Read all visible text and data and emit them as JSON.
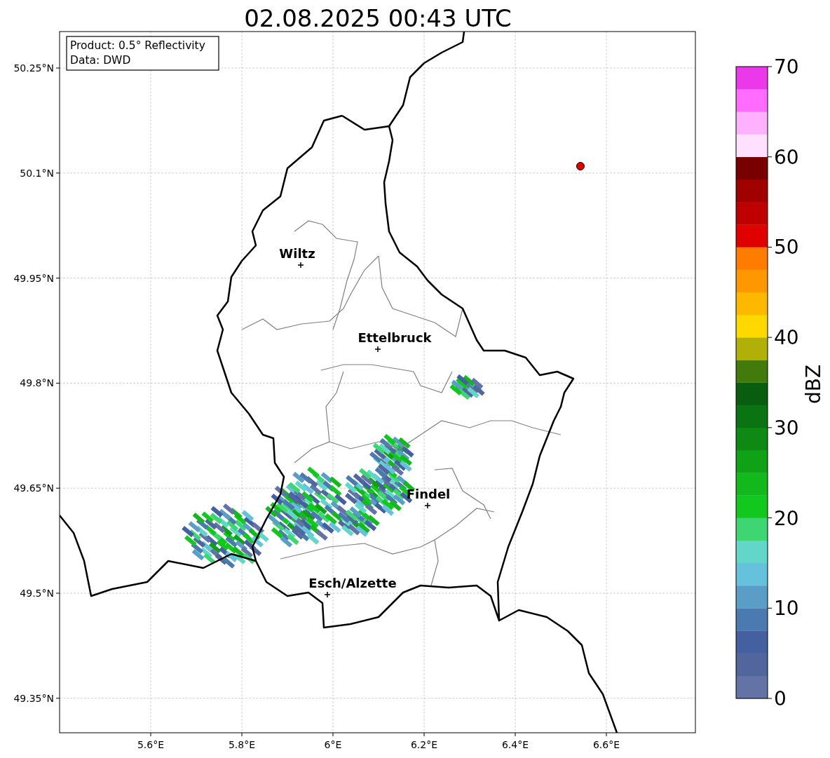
{
  "title": "02.08.2025 00:43 UTC",
  "info_box": [
    "Product: 0.5° Reflectivity",
    "Data: DWD"
  ],
  "map": {
    "yticks": [
      "50.25°N",
      "50.1°N",
      "49.95°N",
      "49.8°N",
      "49.65°N",
      "49.5°N",
      "49.35°N"
    ],
    "xticks": [
      "5.6°E",
      "5.8°E",
      "6°E",
      "6.2°E",
      "6.4°E",
      "6.6°E"
    ],
    "cities": [
      "Wiltz",
      "Ettelbruck",
      "Findel",
      "Esch/Alzette"
    ]
  },
  "colorbar": {
    "label": "dBZ",
    "ticks": [
      "70",
      "60",
      "50",
      "40",
      "30",
      "20",
      "10",
      "0"
    ],
    "bands": [
      {
        "color": "#6473a6"
      },
      {
        "color": "#52669e"
      },
      {
        "color": "#4460a0"
      },
      {
        "color": "#4a7ab0"
      },
      {
        "color": "#5a9ec8"
      },
      {
        "color": "#66c2dc"
      },
      {
        "color": "#62d6c8"
      },
      {
        "color": "#3ed672"
      },
      {
        "color": "#12c81e"
      },
      {
        "color": "#12b81c"
      },
      {
        "color": "#10a216"
      },
      {
        "color": "#0e8a14"
      },
      {
        "color": "#0a7412"
      },
      {
        "color": "#085e0e"
      },
      {
        "color": "#437a0c"
      },
      {
        "color": "#b0b008"
      },
      {
        "color": "#ffd800"
      },
      {
        "color": "#ffb800"
      },
      {
        "color": "#ff9800"
      },
      {
        "color": "#ff7c00"
      },
      {
        "color": "#e00000"
      },
      {
        "color": "#c00000"
      },
      {
        "color": "#a00000"
      },
      {
        "color": "#780000"
      },
      {
        "color": "#ffe0ff"
      },
      {
        "color": "#ffb0ff"
      },
      {
        "color": "#ff6cff"
      },
      {
        "color": "#ea38ea"
      }
    ]
  }
}
